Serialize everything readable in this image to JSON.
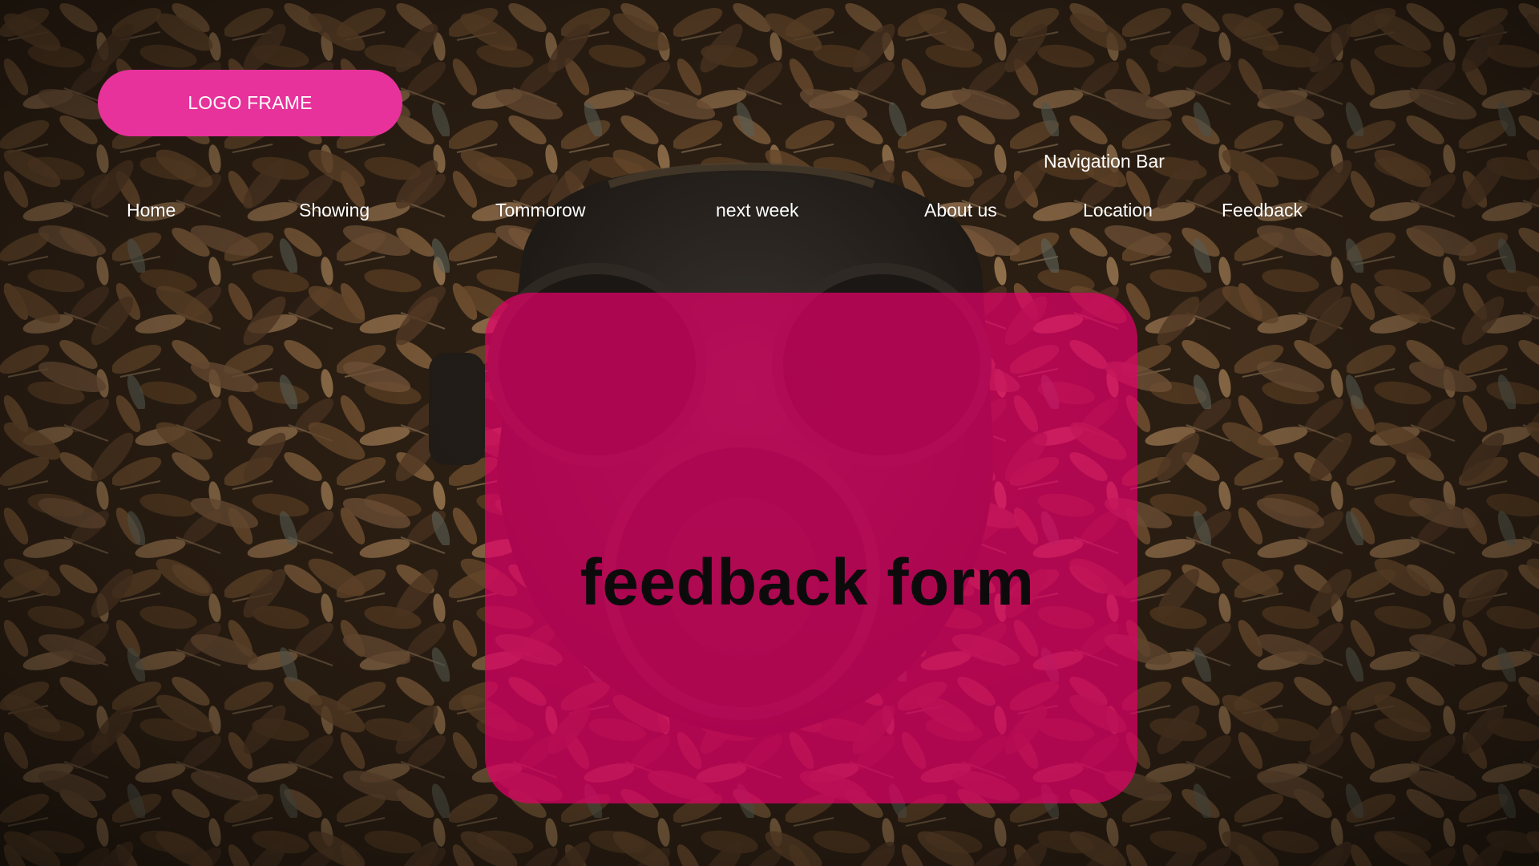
{
  "logo": {
    "label": "LOGO FRAME",
    "color": "#e6329a"
  },
  "navigation": {
    "caption": "Navigation Bar",
    "items": [
      {
        "label": "Home"
      },
      {
        "label": "Showing"
      },
      {
        "label": "Tommorow"
      },
      {
        "label": "next week"
      },
      {
        "label": "About us"
      },
      {
        "label": "Location"
      },
      {
        "label": "Feedback"
      }
    ]
  },
  "main": {
    "title": "feedback form",
    "card_color": "#e40068"
  },
  "background": {
    "image": "gas-mask-in-dry-leaves"
  }
}
